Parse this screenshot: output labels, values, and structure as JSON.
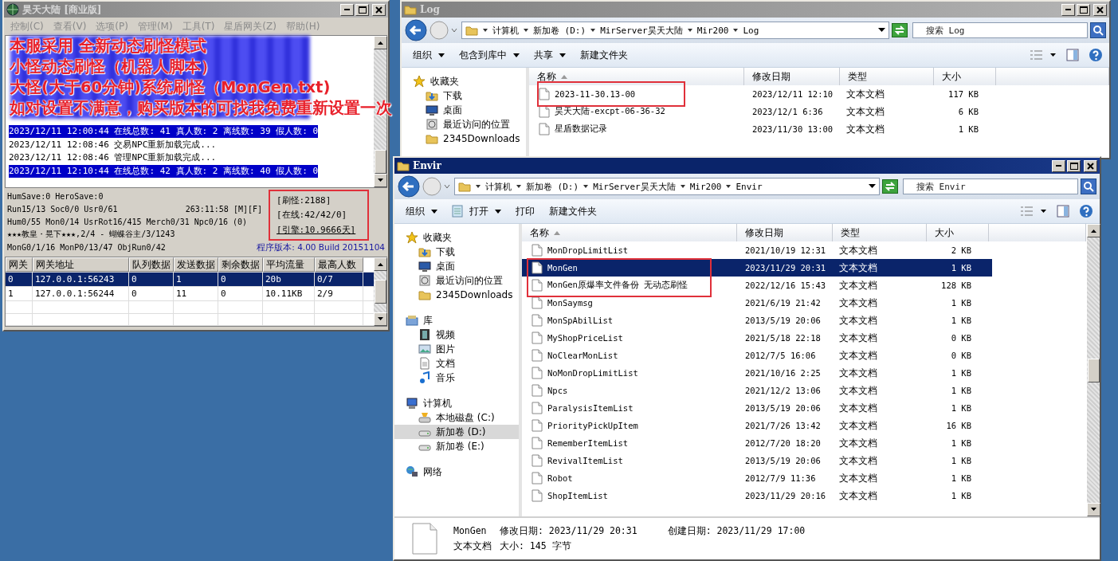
{
  "server_window": {
    "title": "昊天大陆 [商业版]",
    "active": false,
    "menu": [
      "控制(C)",
      "查看(V)",
      "选项(P)",
      "管理(M)",
      "工具(T)",
      "星盾网关(Z)",
      "帮助(H)"
    ],
    "overlay_lines": [
      "本服采用 全新动态刷怪模式",
      "小怪动态刷怪（机器人脚本）",
      "大怪(大于60分钟)系统刷怪（MonGen.txt)",
      "如对设置不满意，购买版本的可找我免费重新设置一次"
    ],
    "log_lines": [
      {
        "text": "2023/12/11 12:00:44 在线总数: 41 真人数: 2 离线数: 39 假人数: 0",
        "highlighted": true
      },
      {
        "text": "2023/12/11 12:08:46 交易NPC重新加载完成...",
        "highlighted": false
      },
      {
        "text": "2023/12/11 12:08:46 管理NPC重新加载完成...",
        "highlighted": false
      },
      {
        "text": "2023/12/11 12:10:44 在线总数: 42 真人数: 2 离线数: 40 假人数: 0",
        "highlighted": true
      }
    ],
    "status_lines": [
      "HumSave:0 HeroSave:0",
      "Run15/13 Soc0/0 Usr0/61",
      "Hum0/55 Mon0/14 UsrRot16/415 Merch0/31 Npc0/16 (0)",
      "★★★教皇・晃下★★★,2/4 - 蝴蝶谷主/3/1243",
      "MonG0/1/16 MonP0/13/47 ObjRun0/42"
    ],
    "uptime": "263:11:58 [M][F]",
    "stats": [
      "[刷怪:2188]",
      "[在线:42/42/0]",
      "[引擎:10.9666天]"
    ],
    "version": "程序版本: 4.00 Build 20151104",
    "gateway_table": {
      "columns": [
        "网关",
        "网关地址",
        "队列数据",
        "发送数据",
        "剩余数据",
        "平均流量",
        "最高人数"
      ],
      "rows": [
        {
          "cells": [
            "0",
            "127.0.0.1:56243",
            "0",
            "1",
            "0",
            "20b",
            "0/7"
          ],
          "selected": true
        },
        {
          "cells": [
            "1",
            "127.0.0.1:56244",
            "0",
            "11",
            "0",
            "10.11KB",
            "2/9"
          ],
          "selected": false
        }
      ]
    }
  },
  "log_window": {
    "title": "Log",
    "active": false,
    "breadcrumb": [
      "计算机",
      "新加卷 (D:)",
      "MirServer昊天大陆",
      "Mir200",
      "Log"
    ],
    "search": {
      "placeholder": "搜索 Log"
    },
    "toolbar": [
      {
        "label": "组织",
        "kind": "menu"
      },
      {
        "label": "包含到库中",
        "kind": "menu"
      },
      {
        "label": "共享",
        "kind": "menu"
      },
      {
        "label": "新建文件夹",
        "kind": "plain"
      }
    ],
    "sidebar": [
      {
        "label": "收藏夹",
        "kind": "star",
        "selected": false,
        "children": [
          {
            "label": "下载",
            "kind": "download",
            "selected": false
          },
          {
            "label": "桌面",
            "kind": "desktop",
            "selected": false
          },
          {
            "label": "最近访问的位置",
            "kind": "recent",
            "selected": false
          },
          {
            "label": "2345Downloads",
            "kind": "folder",
            "selected": false
          }
        ]
      }
    ],
    "columns": [
      "名称",
      "修改日期",
      "类型",
      "大小"
    ],
    "files": [
      {
        "name": "2023-11-30.13-00",
        "modified": "2023/12/11 12:10",
        "type": "文本文档",
        "size": "117 KB",
        "selected": false
      },
      {
        "name": "昊天大陆-excpt-06-36-32",
        "modified": "2023/12/1 6:36",
        "type": "文本文档",
        "size": "6 KB",
        "selected": false
      },
      {
        "name": "星盾数据记录",
        "modified": "2023/11/30 13:00",
        "type": "文本文档",
        "size": "1 KB",
        "selected": false
      }
    ]
  },
  "envir_window": {
    "title": "Envir",
    "active": true,
    "breadcrumb": [
      "计算机",
      "新加卷 (D:)",
      "MirServer昊天大陆",
      "Mir200",
      "Envir"
    ],
    "search": {
      "placeholder": "搜索 Envir"
    },
    "toolbar": [
      {
        "label": "组织",
        "kind": "menu"
      },
      {
        "label": "打开",
        "kind": "open"
      },
      {
        "label": "打印",
        "kind": "plain"
      },
      {
        "label": "新建文件夹",
        "kind": "plain"
      }
    ],
    "sidebar": [
      {
        "label": "收藏夹",
        "kind": "star",
        "selected": false,
        "children": [
          {
            "label": "下载",
            "kind": "download",
            "selected": false
          },
          {
            "label": "桌面",
            "kind": "desktop",
            "selected": false
          },
          {
            "label": "最近访问的位置",
            "kind": "recent",
            "selected": false
          },
          {
            "label": "2345Downloads",
            "kind": "folder",
            "selected": false
          }
        ]
      },
      {
        "label": "库",
        "kind": "library",
        "selected": false,
        "children": [
          {
            "label": "视频",
            "kind": "video",
            "selected": false
          },
          {
            "label": "图片",
            "kind": "image",
            "selected": false
          },
          {
            "label": "文档",
            "kind": "doc",
            "selected": false
          },
          {
            "label": "音乐",
            "kind": "music",
            "selected": false
          }
        ]
      },
      {
        "label": "计算机",
        "kind": "computer",
        "selected": false,
        "children": [
          {
            "label": "本地磁盘 (C:)",
            "kind": "sysdrive",
            "selected": false
          },
          {
            "label": "新加卷 (D:)",
            "kind": "drive",
            "selected": true
          },
          {
            "label": "新加卷 (E:)",
            "kind": "drive",
            "selected": false
          }
        ]
      },
      {
        "label": "网络",
        "kind": "network",
        "selected": false
      }
    ],
    "columns": [
      "名称",
      "修改日期",
      "类型",
      "大小"
    ],
    "files": [
      {
        "name": "MonDropLimitList",
        "modified": "2021/10/19 12:31",
        "type": "文本文档",
        "size": "2 KB",
        "selected": false
      },
      {
        "name": "MonGen",
        "modified": "2023/11/29 20:31",
        "type": "文本文档",
        "size": "1 KB",
        "selected": true
      },
      {
        "name": "MonGen原爆率文件备份 无动态刷怪",
        "modified": "2022/12/16 15:43",
        "type": "文本文档",
        "size": "128 KB",
        "selected": false
      },
      {
        "name": "MonSaymsg",
        "modified": "2021/6/19 21:42",
        "type": "文本文档",
        "size": "1 KB",
        "selected": false
      },
      {
        "name": "MonSpAbilList",
        "modified": "2013/5/19 20:06",
        "type": "文本文档",
        "size": "1 KB",
        "selected": false
      },
      {
        "name": "MyShopPriceList",
        "modified": "2021/5/18 22:18",
        "type": "文本文档",
        "size": "0 KB",
        "selected": false
      },
      {
        "name": "NoClearMonList",
        "modified": "2012/7/5 16:06",
        "type": "文本文档",
        "size": "0 KB",
        "selected": false
      },
      {
        "name": "NoMonDropLimitList",
        "modified": "2021/10/16 2:25",
        "type": "文本文档",
        "size": "1 KB",
        "selected": false
      },
      {
        "name": "Npcs",
        "modified": "2021/12/2 13:06",
        "type": "文本文档",
        "size": "1 KB",
        "selected": false
      },
      {
        "name": "ParalysisItemList",
        "modified": "2013/5/19 20:06",
        "type": "文本文档",
        "size": "1 KB",
        "selected": false
      },
      {
        "name": "PriorityPickUpItem",
        "modified": "2021/7/26 13:42",
        "type": "文本文档",
        "size": "16 KB",
        "selected": false
      },
      {
        "name": "RememberItemList",
        "modified": "2012/7/20 18:20",
        "type": "文本文档",
        "size": "1 KB",
        "selected": false
      },
      {
        "name": "RevivalItemList",
        "modified": "2013/5/19 20:06",
        "type": "文本文档",
        "size": "1 KB",
        "selected": false
      },
      {
        "name": "Robot",
        "modified": "2012/7/9 11:36",
        "type": "文本文档",
        "size": "1 KB",
        "selected": false
      },
      {
        "name": "ShopItemList",
        "modified": "2023/11/29 20:16",
        "type": "文本文档",
        "size": "1 KB",
        "selected": false
      }
    ],
    "details": {
      "name": "MonGen",
      "modified": "修改日期: 2023/11/29 20:31",
      "created": "创建日期: 2023/11/29 17:00",
      "type": "文本文档",
      "size": "大小: 145 字节"
    }
  }
}
